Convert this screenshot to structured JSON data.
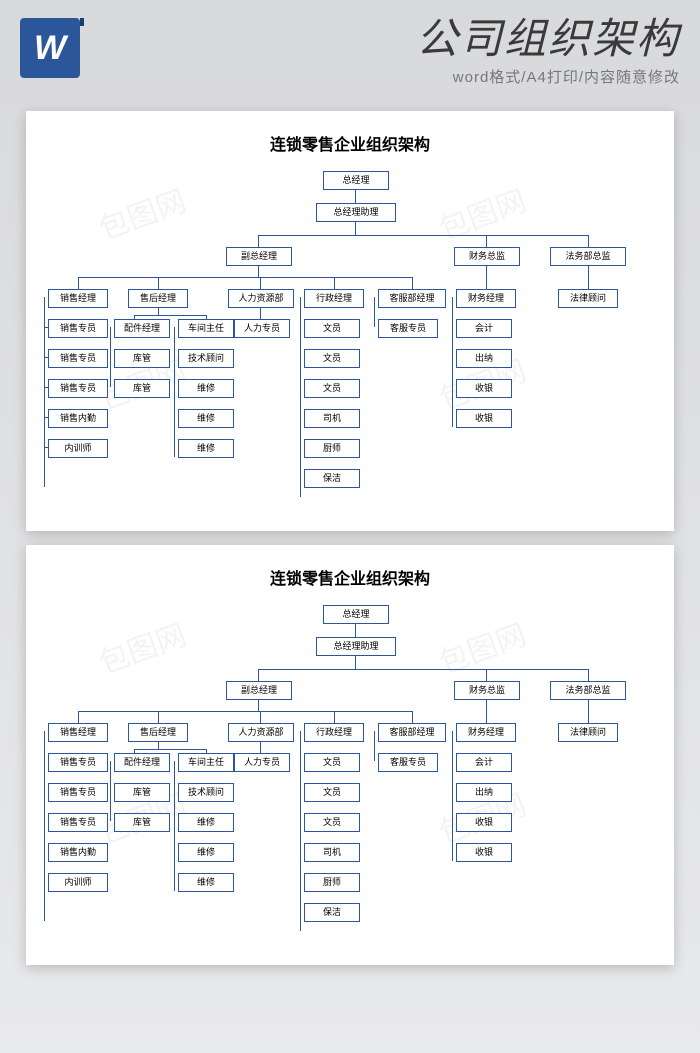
{
  "header": {
    "icon_letter": "W",
    "title": "公司组织架构",
    "subtitle": "word格式/A4打印/内容随意修改"
  },
  "watermark": "包图网",
  "doc": {
    "title": "连锁零售企业组织架构",
    "nodes": {
      "gm": "总经理",
      "gm_assist": "总经理助理",
      "vice_gm": "副总经理",
      "fin_dir": "财务总监",
      "law_dir": "法务部总监",
      "sales_mgr": "销售经理",
      "after_mgr": "售后经理",
      "hr_dept": "人力资源部",
      "admin_mgr": "行政经理",
      "service_mgr": "客服部经理",
      "fin_mgr": "财务经理",
      "law_adv": "法律顾问",
      "sales_spec": "销售专员",
      "sales_intern": "销售内勤",
      "trainer": "内训师",
      "parts_mgr": "配件经理",
      "warehouse": "库管",
      "workshop": "车间主任",
      "tech_adv": "技术顾问",
      "repair": "维修",
      "hr_spec": "人力专员",
      "clerk": "文员",
      "driver": "司机",
      "chef": "厨师",
      "clean": "保洁",
      "service_spec": "客服专员",
      "accountant": "会计",
      "cashier": "出纳",
      "till": "收银"
    }
  }
}
